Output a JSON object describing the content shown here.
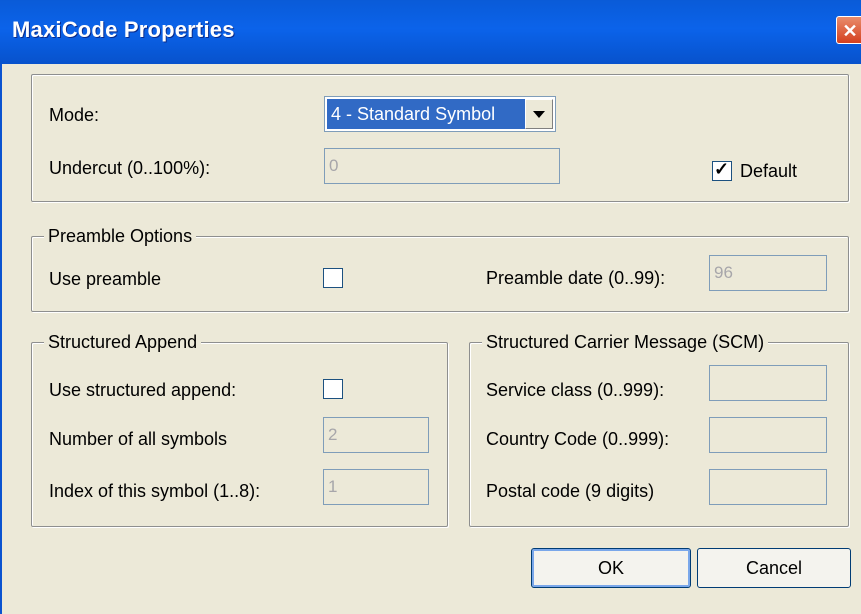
{
  "window": {
    "title": "MaxiCode Properties"
  },
  "mode": {
    "label": "Mode:",
    "value": "4 - Standard Symbol"
  },
  "undercut": {
    "label": "Undercut (0..100%):",
    "value": "0"
  },
  "default_option": {
    "label": "Default",
    "checked": true
  },
  "preamble": {
    "legend": "Preamble Options",
    "use_label": "Use preamble",
    "use_checked": false,
    "date_label": "Preamble date (0..99):",
    "date_value": "96"
  },
  "structured_append": {
    "legend": "Structured Append",
    "use_label": "Use structured append:",
    "use_checked": false,
    "count_label": "Number of all symbols",
    "count_value": "2",
    "index_label": "Index of this symbol (1..8):",
    "index_value": "1"
  },
  "scm": {
    "legend": "Structured Carrier Message (SCM)",
    "service_label": "Service class (0..999):",
    "service_value": "",
    "country_label": "Country Code (0..999):",
    "country_value": "",
    "postal_label": "Postal code (9 digits)",
    "postal_value": ""
  },
  "buttons": {
    "ok": "OK",
    "cancel": "Cancel"
  },
  "colors": {
    "titlebar": "#0b63ea",
    "face": "#ece9d8",
    "selection": "#316ac5"
  }
}
